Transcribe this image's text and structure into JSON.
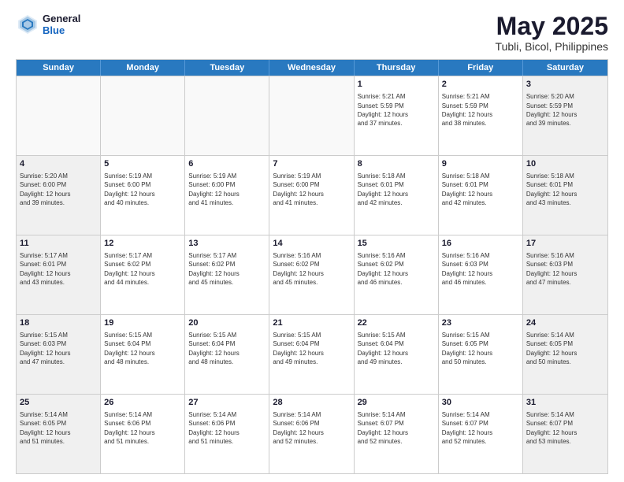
{
  "header": {
    "logo_general": "General",
    "logo_blue": "Blue",
    "title": "May 2025",
    "location": "Tubli, Bicol, Philippines"
  },
  "weekdays": [
    "Sunday",
    "Monday",
    "Tuesday",
    "Wednesday",
    "Thursday",
    "Friday",
    "Saturday"
  ],
  "weeks": [
    [
      {
        "day": "",
        "info": "",
        "empty": true
      },
      {
        "day": "",
        "info": "",
        "empty": true
      },
      {
        "day": "",
        "info": "",
        "empty": true
      },
      {
        "day": "",
        "info": "",
        "empty": true
      },
      {
        "day": "1",
        "info": "Sunrise: 5:21 AM\nSunset: 5:59 PM\nDaylight: 12 hours\nand 37 minutes."
      },
      {
        "day": "2",
        "info": "Sunrise: 5:21 AM\nSunset: 5:59 PM\nDaylight: 12 hours\nand 38 minutes."
      },
      {
        "day": "3",
        "info": "Sunrise: 5:20 AM\nSunset: 5:59 PM\nDaylight: 12 hours\nand 39 minutes."
      }
    ],
    [
      {
        "day": "4",
        "info": "Sunrise: 5:20 AM\nSunset: 6:00 PM\nDaylight: 12 hours\nand 39 minutes."
      },
      {
        "day": "5",
        "info": "Sunrise: 5:19 AM\nSunset: 6:00 PM\nDaylight: 12 hours\nand 40 minutes."
      },
      {
        "day": "6",
        "info": "Sunrise: 5:19 AM\nSunset: 6:00 PM\nDaylight: 12 hours\nand 41 minutes."
      },
      {
        "day": "7",
        "info": "Sunrise: 5:19 AM\nSunset: 6:00 PM\nDaylight: 12 hours\nand 41 minutes."
      },
      {
        "day": "8",
        "info": "Sunrise: 5:18 AM\nSunset: 6:01 PM\nDaylight: 12 hours\nand 42 minutes."
      },
      {
        "day": "9",
        "info": "Sunrise: 5:18 AM\nSunset: 6:01 PM\nDaylight: 12 hours\nand 42 minutes."
      },
      {
        "day": "10",
        "info": "Sunrise: 5:18 AM\nSunset: 6:01 PM\nDaylight: 12 hours\nand 43 minutes."
      }
    ],
    [
      {
        "day": "11",
        "info": "Sunrise: 5:17 AM\nSunset: 6:01 PM\nDaylight: 12 hours\nand 43 minutes."
      },
      {
        "day": "12",
        "info": "Sunrise: 5:17 AM\nSunset: 6:02 PM\nDaylight: 12 hours\nand 44 minutes."
      },
      {
        "day": "13",
        "info": "Sunrise: 5:17 AM\nSunset: 6:02 PM\nDaylight: 12 hours\nand 45 minutes."
      },
      {
        "day": "14",
        "info": "Sunrise: 5:16 AM\nSunset: 6:02 PM\nDaylight: 12 hours\nand 45 minutes."
      },
      {
        "day": "15",
        "info": "Sunrise: 5:16 AM\nSunset: 6:02 PM\nDaylight: 12 hours\nand 46 minutes."
      },
      {
        "day": "16",
        "info": "Sunrise: 5:16 AM\nSunset: 6:03 PM\nDaylight: 12 hours\nand 46 minutes."
      },
      {
        "day": "17",
        "info": "Sunrise: 5:16 AM\nSunset: 6:03 PM\nDaylight: 12 hours\nand 47 minutes."
      }
    ],
    [
      {
        "day": "18",
        "info": "Sunrise: 5:15 AM\nSunset: 6:03 PM\nDaylight: 12 hours\nand 47 minutes."
      },
      {
        "day": "19",
        "info": "Sunrise: 5:15 AM\nSunset: 6:04 PM\nDaylight: 12 hours\nand 48 minutes."
      },
      {
        "day": "20",
        "info": "Sunrise: 5:15 AM\nSunset: 6:04 PM\nDaylight: 12 hours\nand 48 minutes."
      },
      {
        "day": "21",
        "info": "Sunrise: 5:15 AM\nSunset: 6:04 PM\nDaylight: 12 hours\nand 49 minutes."
      },
      {
        "day": "22",
        "info": "Sunrise: 5:15 AM\nSunset: 6:04 PM\nDaylight: 12 hours\nand 49 minutes."
      },
      {
        "day": "23",
        "info": "Sunrise: 5:15 AM\nSunset: 6:05 PM\nDaylight: 12 hours\nand 50 minutes."
      },
      {
        "day": "24",
        "info": "Sunrise: 5:14 AM\nSunset: 6:05 PM\nDaylight: 12 hours\nand 50 minutes."
      }
    ],
    [
      {
        "day": "25",
        "info": "Sunrise: 5:14 AM\nSunset: 6:05 PM\nDaylight: 12 hours\nand 51 minutes."
      },
      {
        "day": "26",
        "info": "Sunrise: 5:14 AM\nSunset: 6:06 PM\nDaylight: 12 hours\nand 51 minutes."
      },
      {
        "day": "27",
        "info": "Sunrise: 5:14 AM\nSunset: 6:06 PM\nDaylight: 12 hours\nand 51 minutes."
      },
      {
        "day": "28",
        "info": "Sunrise: 5:14 AM\nSunset: 6:06 PM\nDaylight: 12 hours\nand 52 minutes."
      },
      {
        "day": "29",
        "info": "Sunrise: 5:14 AM\nSunset: 6:07 PM\nDaylight: 12 hours\nand 52 minutes."
      },
      {
        "day": "30",
        "info": "Sunrise: 5:14 AM\nSunset: 6:07 PM\nDaylight: 12 hours\nand 52 minutes."
      },
      {
        "day": "31",
        "info": "Sunrise: 5:14 AM\nSunset: 6:07 PM\nDaylight: 12 hours\nand 53 minutes."
      }
    ]
  ]
}
